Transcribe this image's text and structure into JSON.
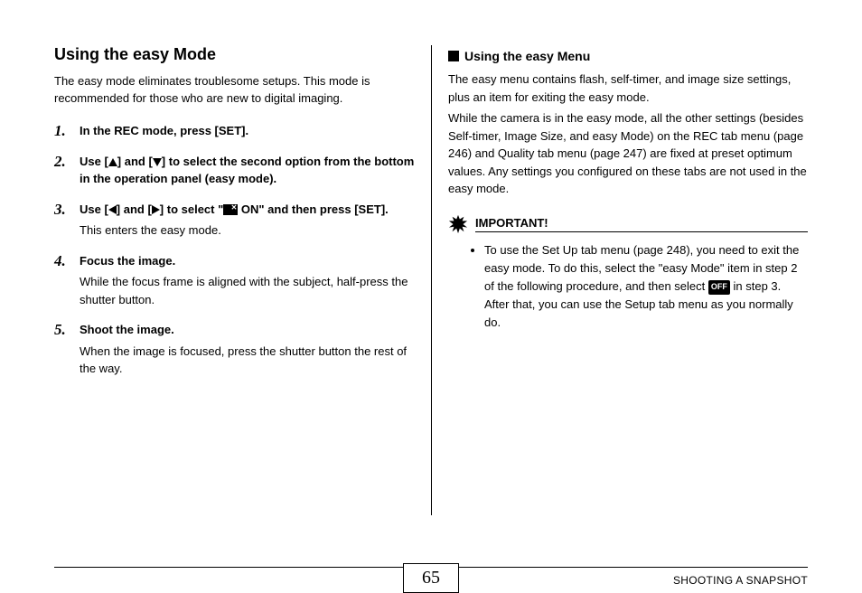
{
  "left": {
    "title": "Using the easy Mode",
    "intro": "The easy mode eliminates troublesome setups. This mode is recommended for those who are new to digital imaging.",
    "steps": [
      {
        "num": "1.",
        "head_parts": [
          "In the REC mode, press [SET]."
        ]
      },
      {
        "num": "2.",
        "head_parts": [
          "Use [",
          {
            "icon": "up"
          },
          "] and [",
          {
            "icon": "down"
          },
          "] to select the second option from the bottom in the operation panel (easy mode)."
        ]
      },
      {
        "num": "3.",
        "head_parts": [
          "Use [",
          {
            "icon": "left"
          },
          "] and [",
          {
            "icon": "right"
          },
          "] to select \"",
          {
            "icon": "mode"
          },
          " ON\" and then press [SET]."
        ],
        "sub": "This enters the easy mode."
      },
      {
        "num": "4.",
        "head_parts": [
          "Focus the image."
        ],
        "sub": "While the focus frame is aligned with the subject, half-press the shutter button."
      },
      {
        "num": "5.",
        "head_parts": [
          "Shoot the image."
        ],
        "sub": "When the image is focused, press the shutter button the rest of the way."
      }
    ]
  },
  "right": {
    "subheading": "Using the easy Menu",
    "para1": "The easy menu contains flash, self-timer, and image size settings, plus an item for exiting the easy mode.",
    "para2": "While the camera is in the easy mode, all the other settings (besides Self-timer, Image Size, and easy Mode) on the REC tab menu (page 246) and Quality tab menu (page 247) are fixed at preset optimum values. Any settings you configured on these tabs are not used in the easy mode.",
    "important_label": "IMPORTANT!",
    "bullet_parts": [
      "To use the Set Up tab menu (page 248), you need to exit the easy mode. To do this, select the \"easy Mode\" item in step 2 of the following procedure, and then select ",
      {
        "icon": "off"
      },
      " in step 3. After that, you can use the Setup tab menu as you normally do."
    ]
  },
  "footer": {
    "page_number": "65",
    "section": "SHOOTING A SNAPSHOT"
  }
}
